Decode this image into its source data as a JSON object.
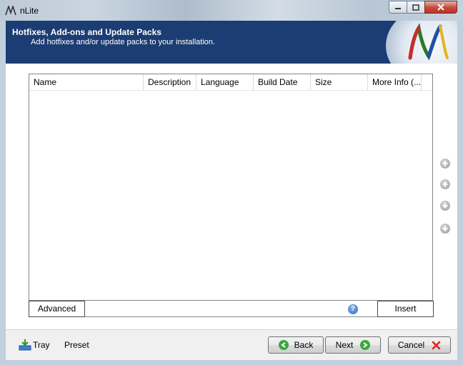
{
  "window": {
    "title": "nLite"
  },
  "header": {
    "title": "Hotfixes, Add-ons and Update Packs",
    "subtitle": "Add hotfixes and/or update packs to your installation."
  },
  "list": {
    "columns": [
      "Name",
      "Description",
      "Language",
      "Build Date",
      "Size",
      "More Info (..."
    ],
    "rows": []
  },
  "buttons": {
    "advanced": "Advanced",
    "insert": "Insert",
    "back": "Back",
    "next": "Next",
    "cancel": "Cancel"
  },
  "footer": {
    "tray": "Tray",
    "preset": "Preset"
  },
  "colors": {
    "banner": "#1c3d73",
    "next_icon": "#3aa83a",
    "cancel_icon": "#d9281b",
    "help_icon": "#2f6fc9"
  }
}
